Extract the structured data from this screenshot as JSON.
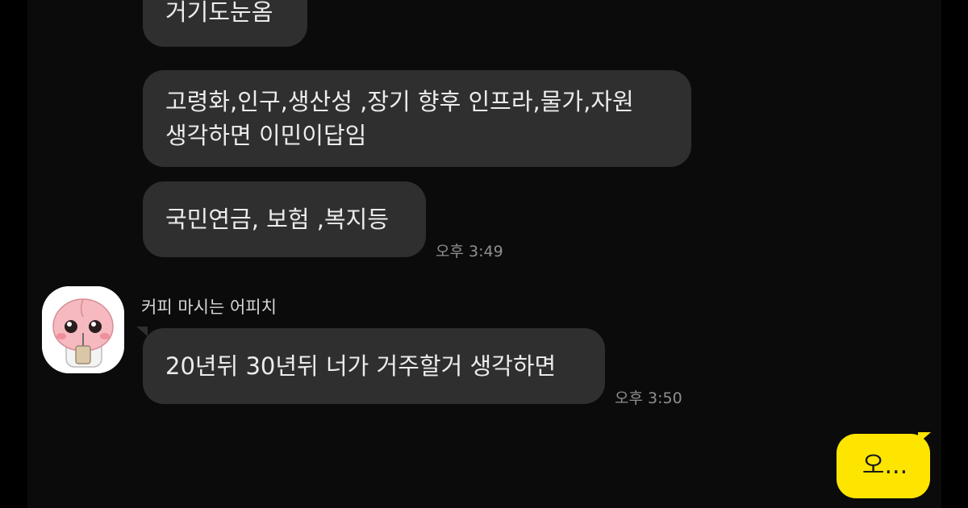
{
  "messages": [
    {
      "text": "거기도눈옴"
    },
    {
      "lines": [
        "고령화,인구,생산성 ,장기 향후 인프라,물가,자원",
        "생각하면 이민이답임"
      ]
    },
    {
      "text": "국민연금, 보험 ,복지등",
      "time": "오후 3:49"
    }
  ],
  "second_sender": {
    "name": "커피 마시는 어피치",
    "avatar_icon": "apeach-coffee-avatar-icon",
    "messages": [
      {
        "text": "20년뒤 30년뒤 너가 거주할거 생각하면",
        "time": "오후 3:50"
      }
    ]
  },
  "my_messages": [
    {
      "text": "오..."
    }
  ],
  "colors": {
    "background": "#0b0b0b",
    "other_bubble": "#2f2f2f",
    "my_bubble": "#fee500",
    "timestamp": "#8f8f8f"
  }
}
